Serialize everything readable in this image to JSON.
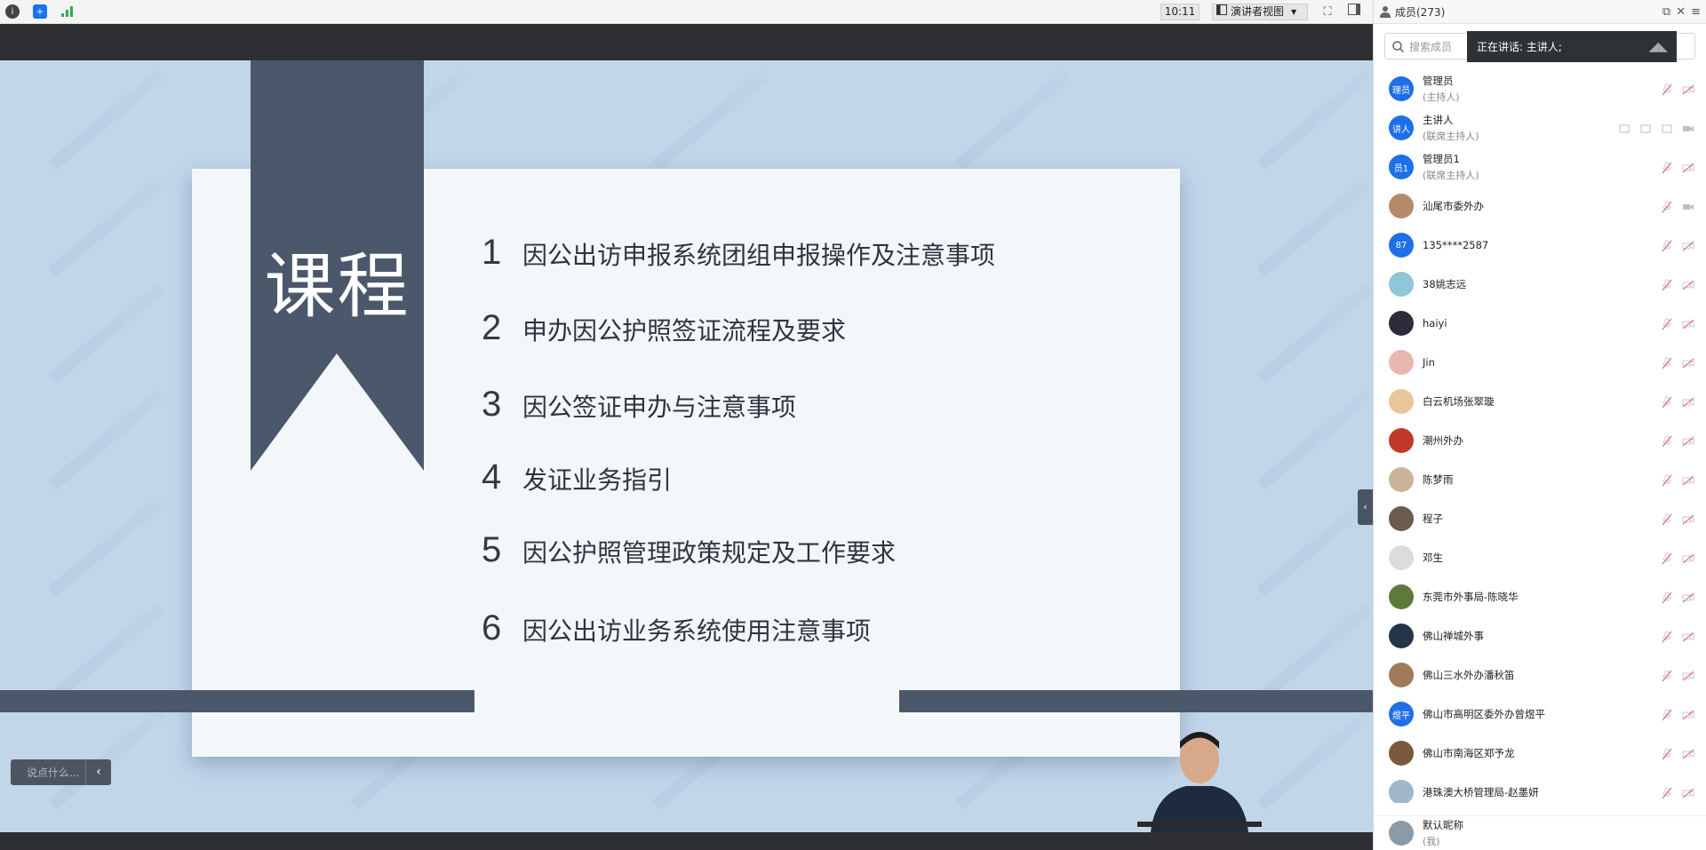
{
  "topbar": {
    "time": "10:11",
    "view_label": "演讲者视图",
    "icons": [
      "info-icon",
      "shield-icon",
      "signal-icon"
    ]
  },
  "slide": {
    "ribbon_title": "课程",
    "items": [
      {
        "num": "1",
        "text": "因公出访申报系统团组申报操作及注意事项"
      },
      {
        "num": "2",
        "text": "申办因公护照签证流程及要求"
      },
      {
        "num": "3",
        "text": "因公签证申办与注意事项"
      },
      {
        "num": "4",
        "text": "发证业务指引"
      },
      {
        "num": "5",
        "text": "因公护照管理政策规定及工作要求"
      },
      {
        "num": "6",
        "text": "因公出访业务系统使用注意事项"
      }
    ]
  },
  "chat": {
    "placeholder": "说点什么..."
  },
  "panel": {
    "title": "成员(273)",
    "search_placeholder": "搜索成员",
    "speaking": "正在讲话: 主讲人;",
    "members": [
      {
        "name": "管理员",
        "sub": "(主持人)",
        "avatar_text": "理员",
        "avatar_color": "#1e6fe8"
      },
      {
        "name": "主讲人",
        "sub": "(联席主持人)",
        "avatar_text": "讲人",
        "avatar_color": "#1e6fe8"
      },
      {
        "name": "管理员1",
        "sub": "(联席主持人)",
        "avatar_text": "员1",
        "avatar_color": "#1e6fe8"
      },
      {
        "name": "汕尾市委外办",
        "sub": "",
        "avatar_text": "",
        "avatar_color": "#b58a6b"
      },
      {
        "name": "135****2587",
        "sub": "",
        "avatar_text": "87",
        "avatar_color": "#1e6fe8"
      },
      {
        "name": "38姚志远",
        "sub": "",
        "avatar_text": "",
        "avatar_color": "#8fc7d8"
      },
      {
        "name": "haiyi",
        "sub": "",
        "avatar_text": "",
        "avatar_color": "#2c2c3a"
      },
      {
        "name": "Jin",
        "sub": "",
        "avatar_text": "",
        "avatar_color": "#e8b8b0"
      },
      {
        "name": "白云机场张翠璇",
        "sub": "",
        "avatar_text": "",
        "avatar_color": "#e9c79a"
      },
      {
        "name": "潮州外办",
        "sub": "",
        "avatar_text": "",
        "avatar_color": "#c0392b"
      },
      {
        "name": "陈梦雨",
        "sub": "",
        "avatar_text": "",
        "avatar_color": "#c9b49a"
      },
      {
        "name": "程子",
        "sub": "",
        "avatar_text": "",
        "avatar_color": "#6b5a4e"
      },
      {
        "name": "邓生",
        "sub": "",
        "avatar_text": "",
        "avatar_color": "#dcdcdc"
      },
      {
        "name": "东莞市外事局-陈晓华",
        "sub": "",
        "avatar_text": "",
        "avatar_color": "#5d7a3a"
      },
      {
        "name": "佛山禅城外事",
        "sub": "",
        "avatar_text": "",
        "avatar_color": "#233548"
      },
      {
        "name": "佛山三水外办潘秋笛",
        "sub": "",
        "avatar_text": "",
        "avatar_color": "#a07b5a"
      },
      {
        "name": "佛山市高明区委外办曾煜平",
        "sub": "",
        "avatar_text": "煜平",
        "avatar_color": "#1e6fe8"
      },
      {
        "name": "佛山市南海区郑予龙",
        "sub": "",
        "avatar_text": "",
        "avatar_color": "#7a5a3c"
      },
      {
        "name": "港珠澳大桥管理局-赵墨妍",
        "sub": "",
        "avatar_text": "",
        "avatar_color": "#9fb7c9"
      }
    ],
    "self": {
      "name": "默认昵称",
      "sub": "(我)"
    }
  }
}
